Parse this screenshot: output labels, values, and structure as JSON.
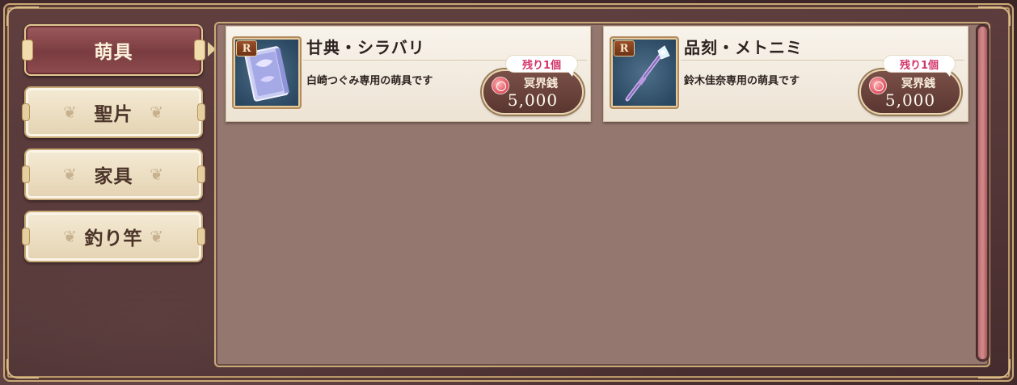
{
  "sidebar": {
    "tabs": [
      {
        "label": "萌具",
        "active": true
      },
      {
        "label": "聖片",
        "active": false
      },
      {
        "label": "家具",
        "active": false
      },
      {
        "label": "釣り竿",
        "active": false
      }
    ]
  },
  "items": [
    {
      "rarity": "R",
      "name": "甘典・シラバリ",
      "description": "白崎つぐみ専用の萌具です",
      "stock": "残り1個",
      "currency": "冥界銭",
      "price": "5,000",
      "icon": "book-icon"
    },
    {
      "rarity": "R",
      "name": "品刻・メトニミ",
      "description": "鈴木佳奈専用の萌具です",
      "stock": "残り1個",
      "currency": "冥界銭",
      "price": "5,000",
      "icon": "wand-icon"
    }
  ],
  "colors": {
    "accent_gold": "#c9a977",
    "active_tab": "#7a3c40",
    "panel": "#94776e",
    "stock_text": "#d2356a"
  }
}
